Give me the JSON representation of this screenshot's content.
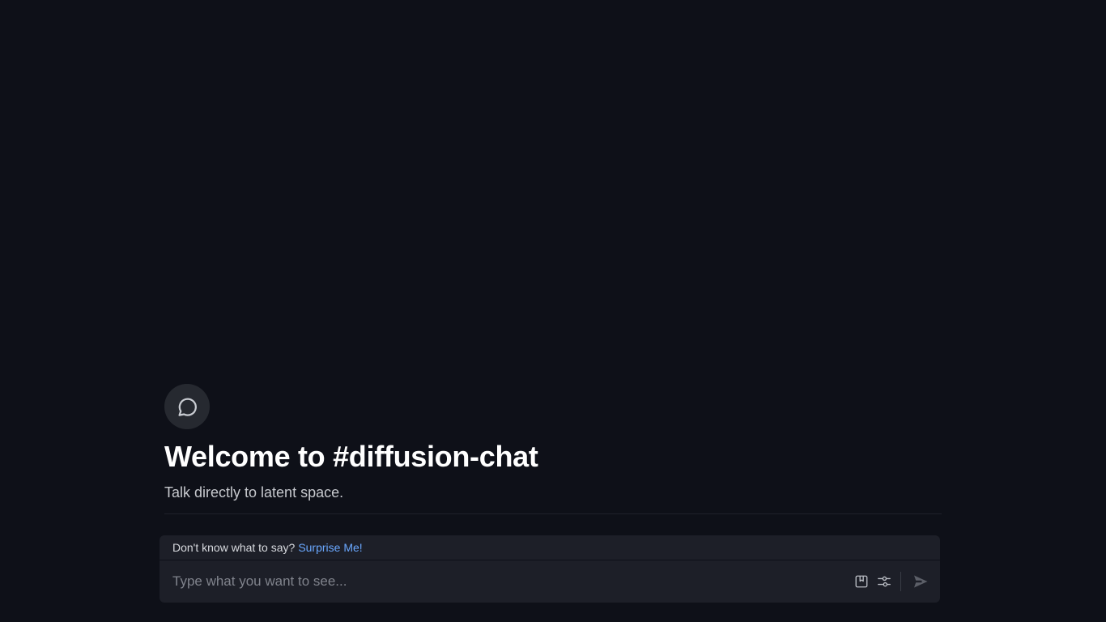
{
  "welcome": {
    "icon": "chat-bubble-icon",
    "title": "Welcome to #diffusion-chat",
    "subtitle": "Talk directly to latent space."
  },
  "composer": {
    "hint_prefix": "Don't know what to say?",
    "hint_link": "Surprise Me!",
    "placeholder": "Type what you want to see...",
    "value": "",
    "icons": {
      "save": "bookmark-icon",
      "settings": "sliders-icon",
      "send": "send-icon"
    }
  },
  "colors": {
    "background": "#0e1018",
    "composer_bg": "#1d1f28",
    "link": "#6aa8ff",
    "title": "#ffffff"
  }
}
